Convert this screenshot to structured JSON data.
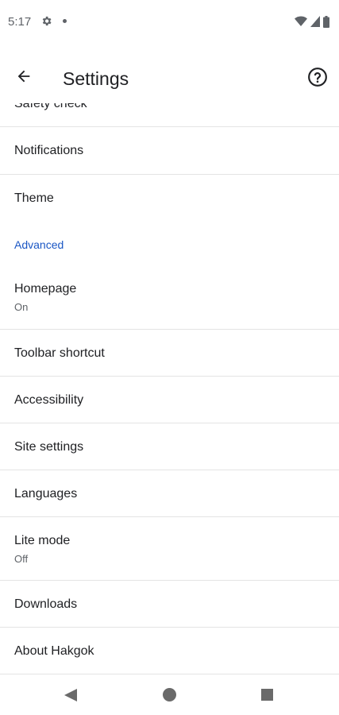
{
  "status_bar": {
    "time": "5:17",
    "icons": [
      "gear-icon",
      "dot-icon",
      "wifi-icon",
      "signal-icon",
      "battery-icon"
    ]
  },
  "app_bar": {
    "title": "Settings",
    "back_icon": "back-arrow-icon",
    "help_icon": "help-circle-icon"
  },
  "settings": {
    "partial_item": "Safety check",
    "items_top": [
      {
        "label": "Notifications"
      },
      {
        "label": "Theme"
      }
    ],
    "advanced_header": "Advanced",
    "homepage": {
      "label": "Homepage",
      "sub": "On"
    },
    "toolbar_shortcut": "Toolbar shortcut",
    "accessibility": "Accessibility",
    "site_settings": "Site settings",
    "languages": "Languages",
    "lite_mode": {
      "label": "Lite mode",
      "sub": "Off"
    },
    "downloads": "Downloads",
    "about": "About Hakgok"
  },
  "nav_bar": {
    "back": "nav-back-icon",
    "home": "nav-home-icon",
    "recents": "nav-recents-icon"
  },
  "colors": {
    "accent": "#1a56c4",
    "text": "#202124",
    "secondary": "#5f6368",
    "divider": "#e4e4e4"
  }
}
